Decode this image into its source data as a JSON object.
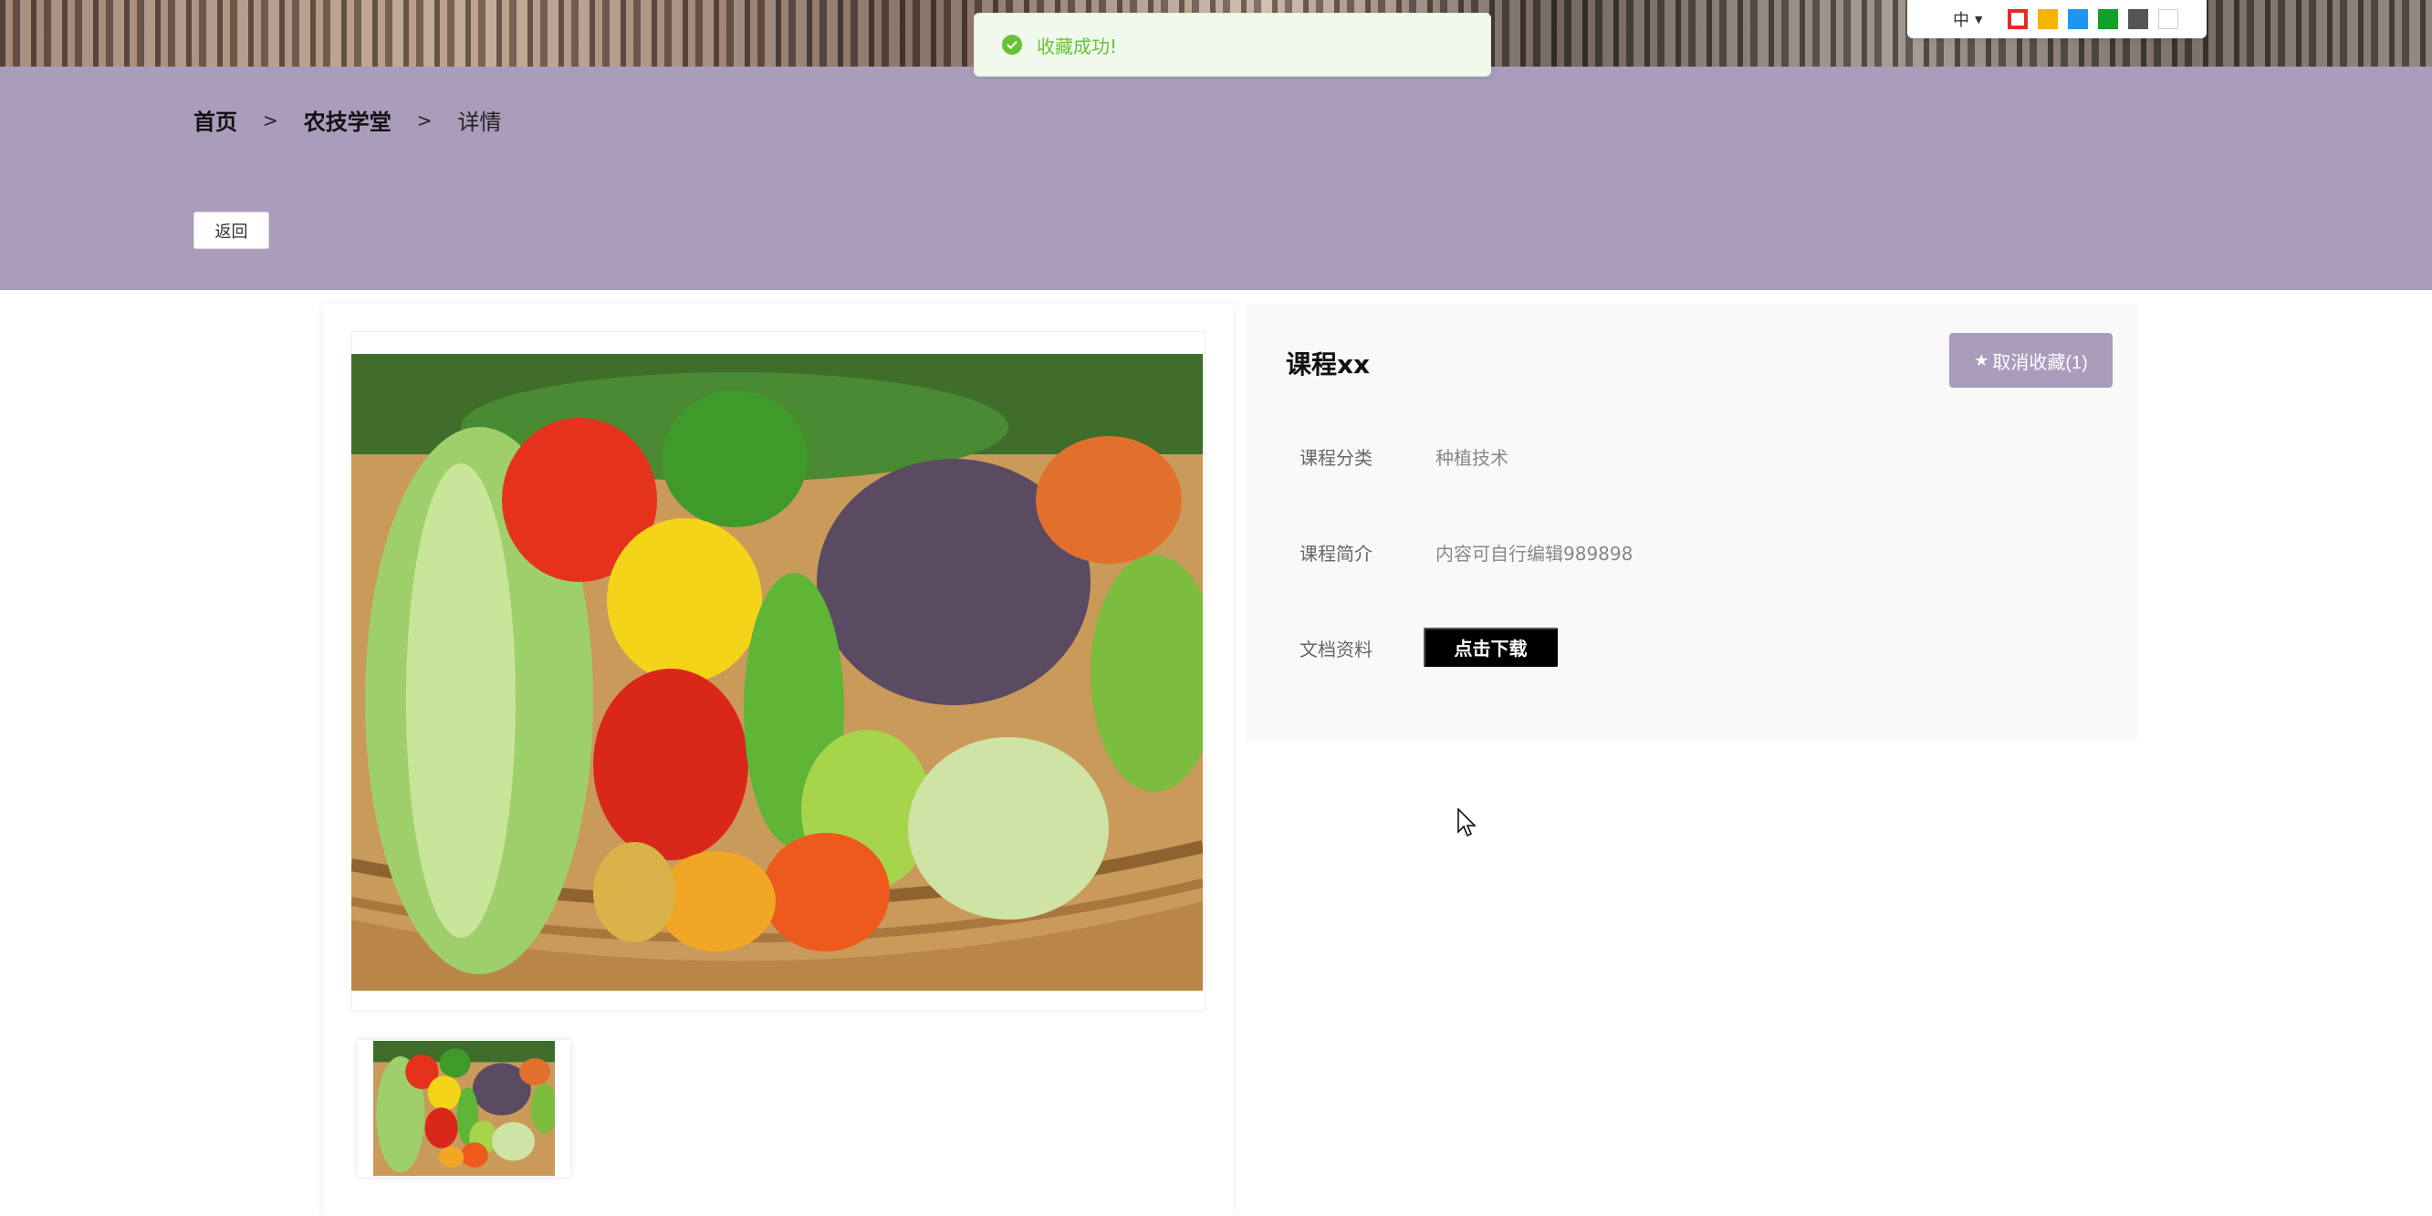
{
  "toast": {
    "message": "收藏成功!",
    "color": "#67c23a"
  },
  "toolbar": {
    "language": "中",
    "swatches": [
      "#e52b1f",
      "#f5b400",
      "#1e96f0",
      "#12a02a",
      "#555555",
      "#ffffff"
    ]
  },
  "breadcrumb": {
    "home": "首页",
    "separator": ">",
    "section": "农技学堂",
    "current": "详情"
  },
  "back_label": "返回",
  "course": {
    "title": "课程xx",
    "favorite_label": "取消收藏(1)",
    "category_label": "课程分类",
    "category_value": "种植技术",
    "intro_label": "课程简介",
    "intro_value": "内容可自行编辑989898",
    "docs_label": "文档资料",
    "download_label": "点击下载"
  },
  "colors": {
    "accent": "#aa9cbb",
    "panel": "#f9f9f9"
  }
}
